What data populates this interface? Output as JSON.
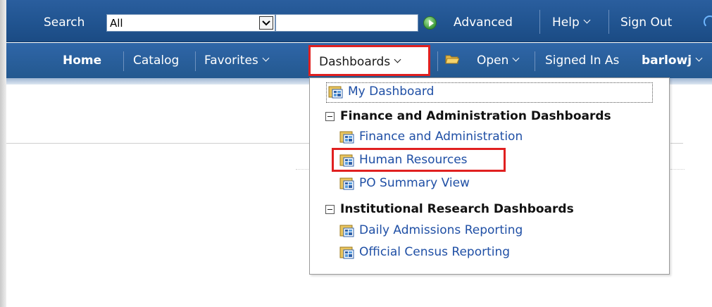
{
  "search": {
    "label": "Search",
    "scope_value": "All",
    "query_value": "",
    "advanced_label": "Advanced",
    "help_label": "Help",
    "signout_label": "Sign Out"
  },
  "nav": {
    "home": "Home",
    "catalog": "Catalog",
    "favorites": "Favorites",
    "dashboards": "Dashboards",
    "open": "Open",
    "signed_in_as": "Signed In As",
    "user": "barlowj"
  },
  "dropdown": {
    "my_dashboard": "My Dashboard",
    "groups": [
      {
        "title": "Finance and Administration Dashboards",
        "items": [
          "Finance and Administration",
          "Human Resources",
          "PO Summary View"
        ]
      },
      {
        "title": "Institutional Research Dashboards",
        "items": [
          "Daily Admissions Reporting",
          "Official Census Reporting"
        ]
      }
    ]
  },
  "colors": {
    "bar_blue": "#20538f",
    "link_blue": "#1f4fa5",
    "highlight_red": "#e02020"
  }
}
